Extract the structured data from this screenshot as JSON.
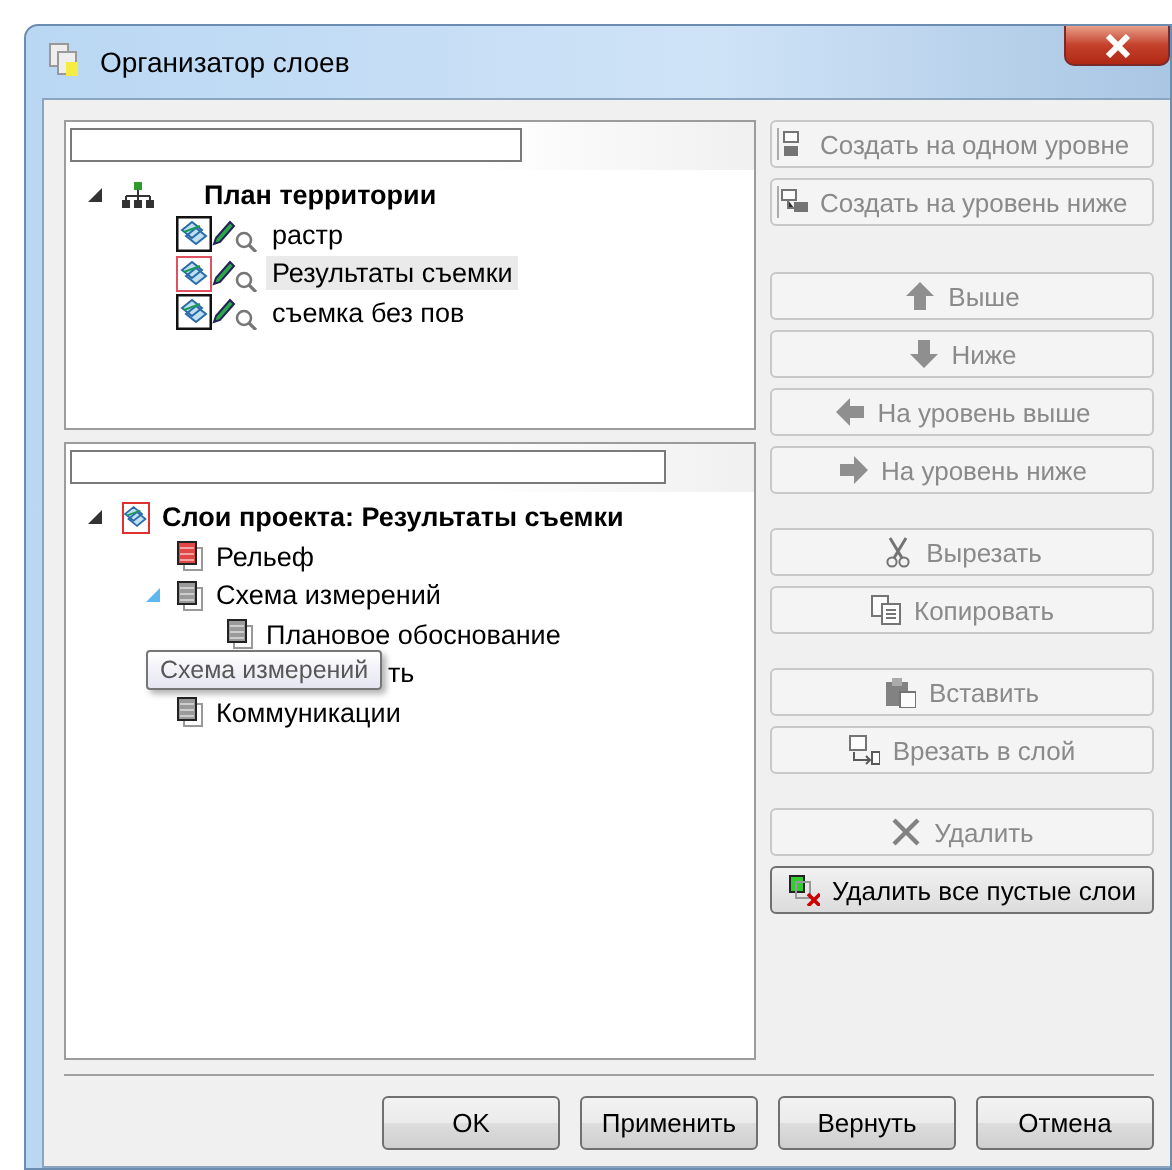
{
  "window": {
    "title": "Организатор слоев"
  },
  "top_tree": {
    "label": "План территории",
    "expanded": true,
    "children": [
      {
        "label": "растр",
        "selected": false
      },
      {
        "label": "Результаты съемки",
        "selected": true
      },
      {
        "label": "съемка без пов",
        "selected": false
      }
    ]
  },
  "bottom_tree": {
    "label": "Слои проекта: Результаты съемки",
    "expanded": true,
    "children": [
      {
        "label": "Рельеф",
        "kind": "layer",
        "color": "#e04848"
      },
      {
        "label": "Схема измерений",
        "kind": "layer",
        "color": "#9a9a9a",
        "expanded": true,
        "children": [
          {
            "label": "Плановое обоснование",
            "kind": "layer",
            "color": "#9a9a9a"
          }
        ]
      },
      {
        "label": "ть",
        "kind": "obscured"
      },
      {
        "label": "Коммуникации",
        "kind": "layer",
        "color": "#9a9a9a"
      }
    ]
  },
  "tooltip": {
    "text": "Схема измерений"
  },
  "button_groups": [
    [
      {
        "label": "Создать на одном уровне",
        "kind": "sibling",
        "disabled": true
      },
      {
        "label": "Создать на уровень ниже",
        "kind": "child",
        "disabled": true
      }
    ],
    [
      {
        "label": "Выше",
        "kind": "up",
        "disabled": true
      },
      {
        "label": "Ниже",
        "kind": "down",
        "disabled": true
      },
      {
        "label": "На уровень выше",
        "kind": "left",
        "disabled": true
      },
      {
        "label": "На уровень ниже",
        "kind": "right",
        "disabled": true
      }
    ],
    [
      {
        "label": "Вырезать",
        "kind": "cut",
        "disabled": true
      },
      {
        "label": "Копировать",
        "kind": "copy",
        "disabled": true
      }
    ],
    [
      {
        "label": "Вставить",
        "kind": "paste",
        "disabled": true
      },
      {
        "label": "Врезать в слой",
        "kind": "cutinto",
        "disabled": true
      }
    ],
    [
      {
        "label": "Удалить",
        "kind": "delete",
        "disabled": true
      },
      {
        "label": "Удалить все пустые слои",
        "kind": "purge",
        "disabled": false
      }
    ]
  ],
  "footer_buttons": [
    "OK",
    "Применить",
    "Вернуть",
    "Отмена"
  ]
}
